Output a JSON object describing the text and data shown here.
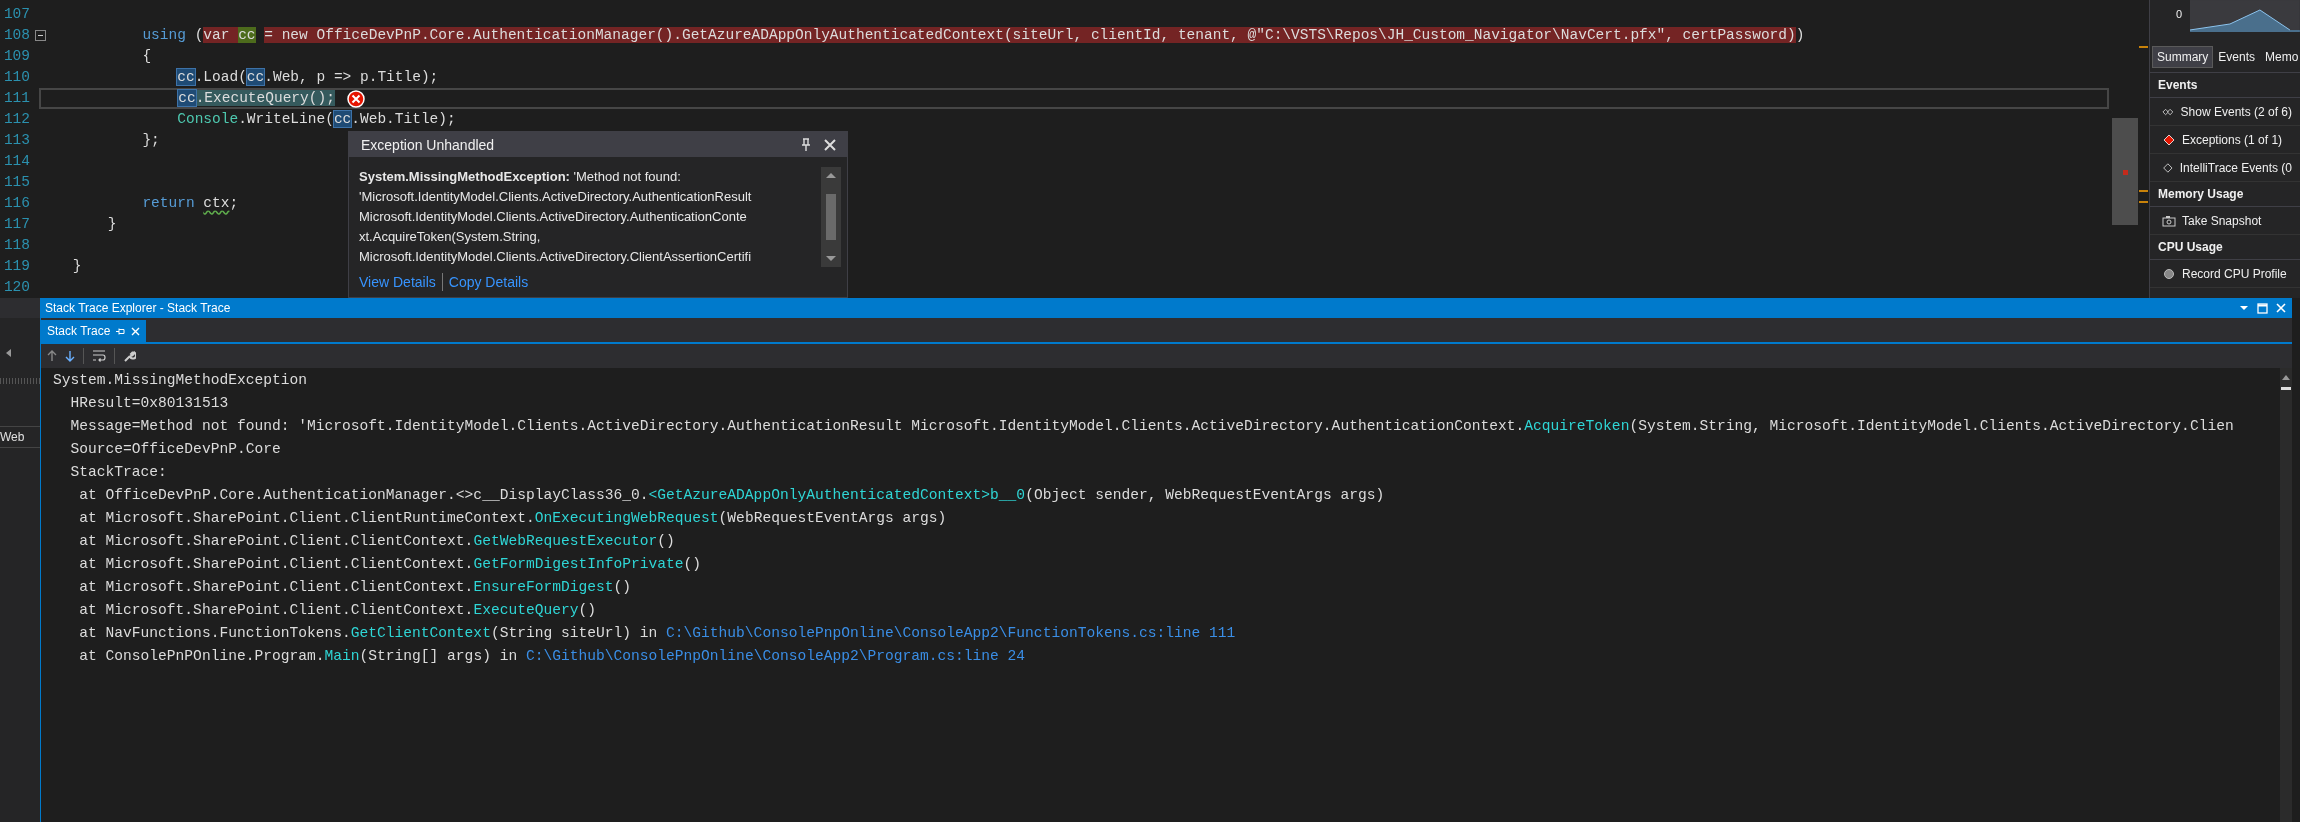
{
  "editor": {
    "lines": [
      {
        "number": "107"
      },
      {
        "number": "108",
        "fold": true,
        "segments": [
          {
            "text": "            using",
            "kind": "keyword"
          },
          {
            "text": " (",
            "kind": "plain"
          },
          {
            "text": "var ",
            "kind": "plain",
            "error_highlight": true
          },
          {
            "text": "cc",
            "kind": "plain",
            "definition_highlight": true
          },
          {
            "text": " = new OfficeDevPnP.Core.AuthenticationManager().GetAzureADAppOnlyAuthenticatedContext(siteUrl, clientId, tenant, @\"C:\\VSTS\\Repos\\JH_Custom_Navigator\\NavCert.pfx\", certPassword)",
            "kind": "plain",
            "error_highlight": true
          },
          {
            "text": ")",
            "kind": "plain"
          }
        ]
      },
      {
        "number": "109",
        "segments": [
          {
            "text": "            {",
            "kind": "plain"
          }
        ]
      },
      {
        "number": "110",
        "segments": [
          {
            "text": "                cc",
            "kind": "plain",
            "reference_highlight": true
          },
          {
            "text": ".Load(",
            "kind": "plain"
          },
          {
            "text": "cc",
            "kind": "plain",
            "reference_highlight": true
          },
          {
            "text": ".Web, p => p.Title);",
            "kind": "plain"
          }
        ]
      },
      {
        "number": "111",
        "current": true,
        "error": true,
        "segments": [
          {
            "text": "                cc",
            "kind": "plain",
            "reference_highlight": true
          },
          {
            "text": ".ExecuteQuery();",
            "kind": "plain",
            "statement_highlight": true
          }
        ]
      },
      {
        "number": "112",
        "segments": [
          {
            "text": "                Console",
            "kind": "type"
          },
          {
            "text": ".WriteLine(",
            "kind": "plain"
          },
          {
            "text": "cc",
            "kind": "plain",
            "reference_highlight": true
          },
          {
            "text": ".Web.Title);",
            "kind": "plain"
          }
        ]
      },
      {
        "number": "113",
        "segments": [
          {
            "text": "            };",
            "kind": "plain"
          }
        ]
      },
      {
        "number": "114"
      },
      {
        "number": "115"
      },
      {
        "number": "116",
        "segments": [
          {
            "text": "            return ",
            "kind": "keyword"
          },
          {
            "text": "ctx",
            "kind": "plain",
            "warning_squiggle": true
          },
          {
            "text": ";",
            "kind": "plain"
          }
        ]
      },
      {
        "number": "117",
        "segments": [
          {
            "text": "        }",
            "kind": "plain"
          }
        ]
      },
      {
        "number": "118"
      },
      {
        "number": "119",
        "segments": [
          {
            "text": "    }",
            "kind": "plain"
          }
        ]
      },
      {
        "number": "120"
      }
    ]
  },
  "exception_popup": {
    "title": "Exception Unhandled",
    "message_lines": [
      "**System.MissingMethodException:** 'Method not found:",
      "'Microsoft.IdentityModel.Clients.ActiveDirectory.AuthenticationResult",
      "Microsoft.IdentityModel.Clients.ActiveDirectory.AuthenticationConte",
      "xt.AcquireToken(System.String,",
      "Microsoft.IdentityModel.Clients.ActiveDirectory.ClientAssertionCertifi"
    ],
    "links": [
      "View Details",
      "Copy Details"
    ]
  },
  "diagnostics": {
    "axis_label": "0",
    "tabs": [
      {
        "label": "Summary",
        "selected": true
      },
      {
        "label": "Events",
        "selected": false
      },
      {
        "label": "Memo",
        "selected": false
      }
    ],
    "sections": [
      {
        "title": "Events",
        "items": [
          {
            "label": "Show Events (2 of 6)",
            "kind": "events"
          },
          {
            "label": "Exceptions (1 of 1)",
            "kind": "exception"
          },
          {
            "label": "IntelliTrace Events (0",
            "kind": "trace"
          }
        ]
      },
      {
        "title": "Memory Usage",
        "items": [
          {
            "label": "Take Snapshot",
            "kind": "snapshot"
          }
        ]
      },
      {
        "title": "CPU Usage",
        "items": [
          {
            "label": "Record CPU Profile",
            "kind": "record"
          }
        ]
      }
    ]
  },
  "left_panel": {
    "item": "Web"
  },
  "stack_panel": {
    "title": "Stack Trace Explorer - Stack Trace",
    "tab": {
      "label": "Stack Trace",
      "selected": true
    },
    "lines": [
      [
        {
          "text": "System.MissingMethodException",
          "kind": "plain"
        }
      ],
      [
        {
          "text": "  HResult=0x80131513",
          "kind": "plain"
        }
      ],
      [
        {
          "text": "  Message=Method not found: 'Microsoft.IdentityModel.Clients.ActiveDirectory.AuthenticationResult Microsoft.IdentityModel.Clients.ActiveDirectory.AuthenticationContext.",
          "kind": "plain"
        },
        {
          "text": "AcquireToken",
          "kind": "method"
        },
        {
          "text": "(System.String, Microsoft.IdentityModel.Clients.ActiveDirectory.Clien",
          "kind": "plain"
        }
      ],
      [
        {
          "text": "  Source=OfficeDevPnP.Core",
          "kind": "plain"
        }
      ],
      [
        {
          "text": "  StackTrace:",
          "kind": "plain"
        }
      ],
      [
        {
          "text": "   at OfficeDevPnP.Core.AuthenticationManager.<>c__DisplayClass36_0.",
          "kind": "plain"
        },
        {
          "text": "<GetAzureADAppOnlyAuthenticatedContext>b__0",
          "kind": "method"
        },
        {
          "text": "(Object sender, WebRequestEventArgs args)",
          "kind": "plain"
        }
      ],
      [
        {
          "text": "   at Microsoft.SharePoint.Client.ClientRuntimeContext.",
          "kind": "plain"
        },
        {
          "text": "OnExecutingWebRequest",
          "kind": "method"
        },
        {
          "text": "(WebRequestEventArgs args)",
          "kind": "plain"
        }
      ],
      [
        {
          "text": "   at Microsoft.SharePoint.Client.ClientContext.",
          "kind": "plain"
        },
        {
          "text": "GetWebRequestExecutor",
          "kind": "method"
        },
        {
          "text": "()",
          "kind": "plain"
        }
      ],
      [
        {
          "text": "   at Microsoft.SharePoint.Client.ClientContext.",
          "kind": "plain"
        },
        {
          "text": "GetFormDigestInfoPrivate",
          "kind": "method"
        },
        {
          "text": "()",
          "kind": "plain"
        }
      ],
      [
        {
          "text": "   at Microsoft.SharePoint.Client.ClientContext.",
          "kind": "plain"
        },
        {
          "text": "EnsureFormDigest",
          "kind": "method"
        },
        {
          "text": "()",
          "kind": "plain"
        }
      ],
      [
        {
          "text": "   at Microsoft.SharePoint.Client.ClientContext.",
          "kind": "plain"
        },
        {
          "text": "ExecuteQuery",
          "kind": "method"
        },
        {
          "text": "()",
          "kind": "plain"
        }
      ],
      [
        {
          "text": "   at NavFunctions.FunctionTokens.",
          "kind": "plain"
        },
        {
          "text": "GetClientContext",
          "kind": "method"
        },
        {
          "text": "(String siteUrl) in ",
          "kind": "plain"
        },
        {
          "text": "C:\\Github\\ConsolePnpOnline\\ConsoleApp2\\FunctionTokens.cs:line 111",
          "kind": "link"
        }
      ],
      [
        {
          "text": "   at ConsolePnPOnline.Program.",
          "kind": "plain"
        },
        {
          "text": "Main",
          "kind": "method"
        },
        {
          "text": "(String[] args) in ",
          "kind": "plain"
        },
        {
          "text": "C:\\Github\\ConsolePnpOnline\\ConsoleApp2\\Program.cs:line 24",
          "kind": "link"
        }
      ]
    ]
  }
}
